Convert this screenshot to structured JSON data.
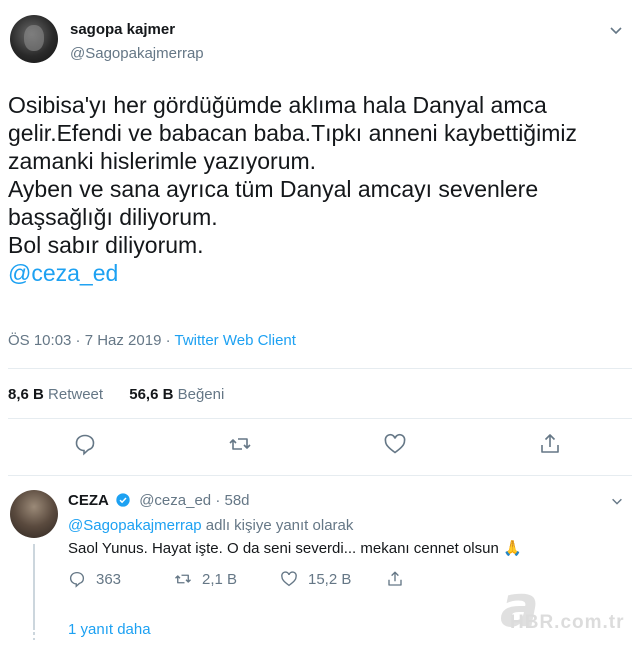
{
  "tweet": {
    "author_name": "sagopa kajmer",
    "author_handle": "@Sagopakajmerrap",
    "lines": [
      "Osibisa'yı her gördüğümde aklıma hala Danyal amca",
      "gelir.Efendi ve babacan baba.Tıpkı anneni kaybettiğimiz",
      "zamanki hislerimle yazıyorum.",
      "Ayben ve sana ayrıca tüm Danyal amcayı sevenlere",
      "başsağlığı diliyorum.",
      "Bol sabır diliyorum."
    ],
    "mention": "@ceza_ed",
    "timestamp": "ÖS 10:03 · 7 Haz 2019 · ",
    "client": "Twitter Web Client",
    "retweet_count": "8,6 B",
    "retweet_label": "Retweet",
    "like_count": "56,6 B",
    "like_label": "Beğeni"
  },
  "reply": {
    "author_name": "CEZA",
    "author_handle": "@ceza_ed",
    "time": "· 58d",
    "reply_to_handle": "@Sagopakajmerrap",
    "reply_to_suffix": " adlı kişiye yanıt olarak",
    "text": "Saol Yunus. Hayat işte. O da seni severdi... mekanı cennet olsun ",
    "emoji": "🙏",
    "reply_count": "363",
    "retweet_count": "2,1 B",
    "like_count": "15,2 B",
    "more_replies": "1 yanıt daha"
  },
  "watermark": {
    "text": "HBR.com.tr",
    "letter": "a"
  },
  "colors": {
    "accent": "#1da1f2",
    "muted": "#657786",
    "text": "#14171a",
    "divider": "#e6ecf0"
  },
  "icons": [
    "chevron-down-icon",
    "reply-icon",
    "retweet-icon",
    "heart-icon",
    "share-icon",
    "verified-icon"
  ]
}
